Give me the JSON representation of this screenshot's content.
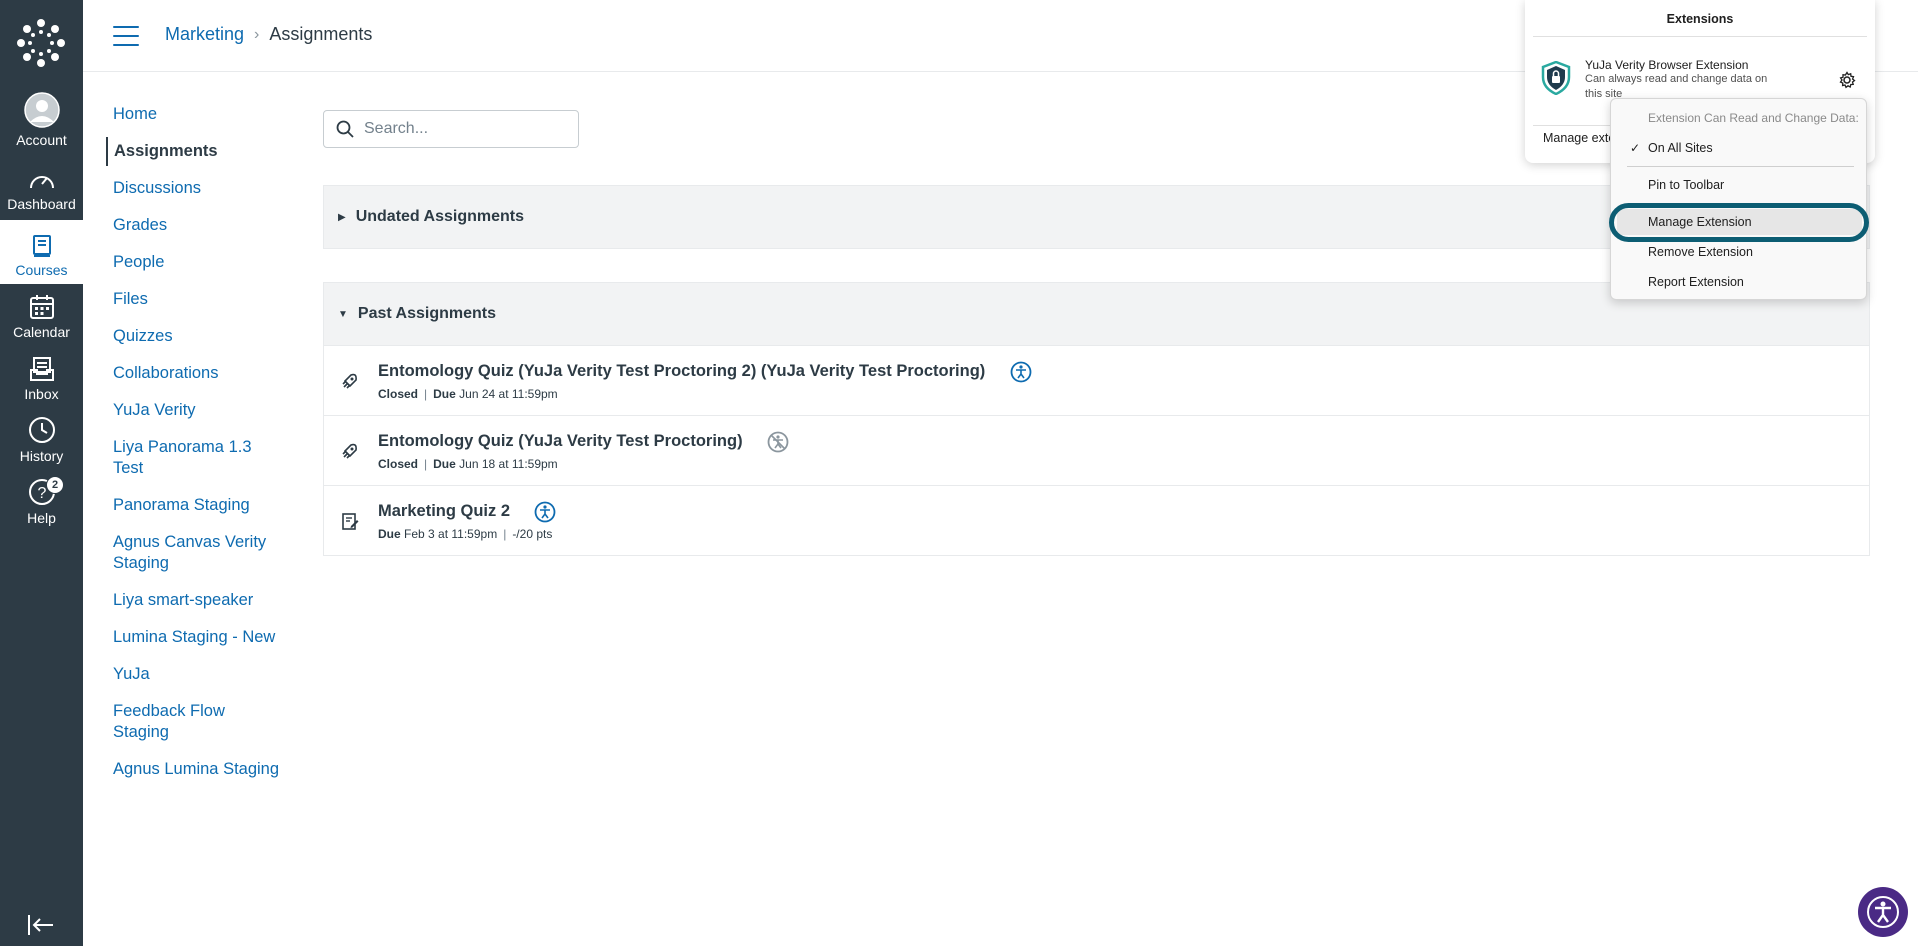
{
  "global_nav": {
    "items": [
      {
        "label": "Account",
        "icon": "account-icon"
      },
      {
        "label": "Dashboard",
        "icon": "dashboard-icon"
      },
      {
        "label": "Courses",
        "icon": "courses-icon",
        "active": true
      },
      {
        "label": "Calendar",
        "icon": "calendar-icon"
      },
      {
        "label": "Inbox",
        "icon": "inbox-icon"
      },
      {
        "label": "History",
        "icon": "history-icon"
      },
      {
        "label": "Help",
        "icon": "help-icon",
        "badge": "2"
      }
    ]
  },
  "header": {
    "breadcrumb": {
      "course": "Marketing",
      "page": "Assignments"
    }
  },
  "course_nav": {
    "items": [
      "Home",
      "Assignments",
      "Discussions",
      "Grades",
      "People",
      "Files",
      "Quizzes",
      "Collaborations",
      "YuJa Verity",
      "Liya Panorama 1.3 Test",
      "Panorama Staging",
      "Agnus Canvas Verity Staging",
      "Liya smart-speaker",
      "Lumina Staging - New",
      "YuJa",
      "Feedback Flow Staging",
      "Agnus Lumina Staging"
    ],
    "active": "Assignments"
  },
  "search": {
    "placeholder": "Search..."
  },
  "groups": {
    "undated": {
      "title": "Undated Assignments"
    },
    "past": {
      "title": "Past Assignments",
      "assignments": [
        {
          "title": "Entomology Quiz (YuJa Verity Test Proctoring 2) (YuJa Verity Test Proctoring)",
          "status": "Closed",
          "due_label": "Due",
          "due": "Jun 24 at 11:59pm",
          "icon": "quiz-rocket-icon"
        },
        {
          "title": "Entomology Quiz (YuJa Verity Test Proctoring)",
          "status": "Closed",
          "due_label": "Due",
          "due": "Jun 18 at 11:59pm",
          "icon": "quiz-rocket-icon"
        },
        {
          "title": "Marketing Quiz 2",
          "due_label": "Due",
          "due": "Feb 3 at 11:59pm",
          "points": "-/20 pts",
          "icon": "quiz-icon"
        }
      ]
    }
  },
  "extensions_panel": {
    "title": "Extensions",
    "extension": {
      "name": "YuJa Verity Browser Extension",
      "description": "Can always read and change data on this site"
    },
    "manage_label": "Manage extensions"
  },
  "context_menu": {
    "header": "Extension Can Read and Change Data:",
    "on_all_sites": "On All Sites",
    "pin": "Pin to Toolbar",
    "manage": "Manage Extension",
    "remove": "Remove Extension",
    "report": "Report Extension"
  },
  "colors": {
    "nav_bg": "#2d3b45",
    "link": "#0e6bb0",
    "highlight_ring": "#0c5d73",
    "fab": "#4a2a85"
  }
}
